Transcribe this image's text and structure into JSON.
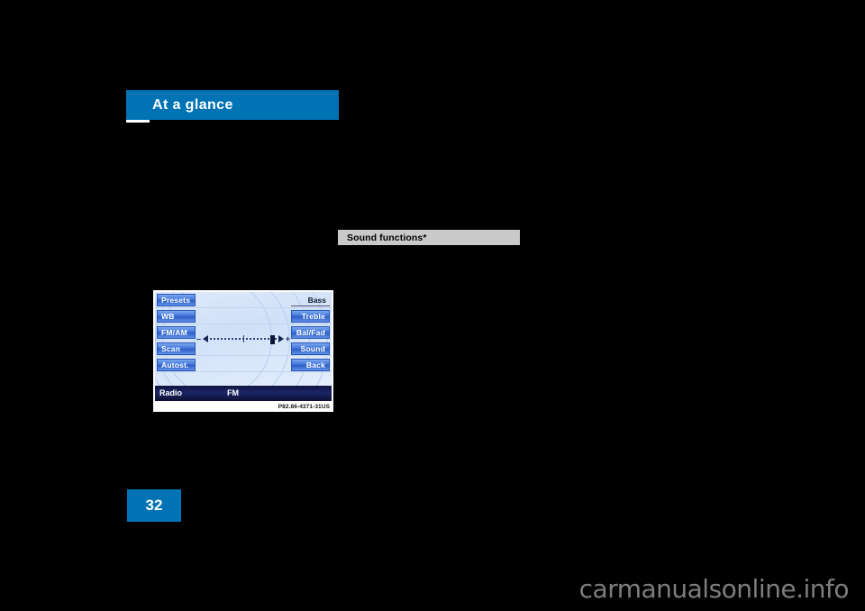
{
  "page": {
    "background_color": "#000000",
    "accent_color": "#0073b5",
    "number": "32",
    "watermark": "carmanualsonline.info"
  },
  "chapter_header": {
    "title": "At a glance"
  },
  "section_label": {
    "text": "Sound functions*"
  },
  "figure": {
    "caption": "P82.86-4371-31US",
    "display": {
      "left_buttons": [
        {
          "label": "Presets",
          "name": "presets"
        },
        {
          "label": "WB",
          "name": "wb"
        },
        {
          "label": "FM/AM",
          "name": "fm-am"
        },
        {
          "label": "Scan",
          "name": "scan"
        },
        {
          "label": "Autost.",
          "name": "autostore"
        }
      ],
      "right_items": [
        {
          "label": "Bass",
          "name": "bass",
          "selected": true
        },
        {
          "label": "Treble",
          "name": "treble",
          "selected": false
        },
        {
          "label": "Bal/Fad",
          "name": "bal-fad",
          "selected": false
        },
        {
          "label": "Sound",
          "name": "sound",
          "selected": false
        },
        {
          "label": "Back",
          "name": "back",
          "selected": false
        }
      ],
      "slider": {
        "minus_sign": "–",
        "plus_sign": "+",
        "left_icon": "speaker-left-icon",
        "right_icon": "speaker-right-icon"
      },
      "status_bar": {
        "source": "Radio",
        "band": "FM"
      }
    }
  }
}
